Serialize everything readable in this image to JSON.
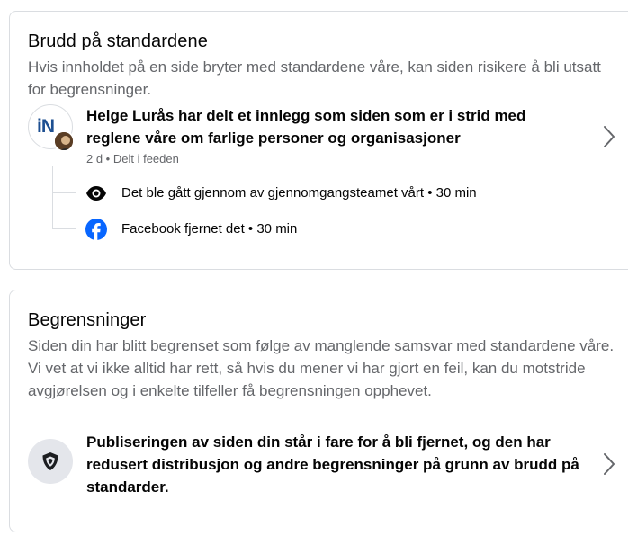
{
  "violations": {
    "title": "Brudd på standardene",
    "description": "Hvis innholdet på en side bryter med standardene våre, kan siden risikere å bli utsatt for begrensninger.",
    "item": {
      "avatar_text": "iN",
      "title": "Helge Lurås har delt et innlegg som siden som er i strid med reglene våre om farlige personer og organisasjoner",
      "meta": "2 d • Delt i feeden",
      "steps": [
        {
          "icon": "eye-icon",
          "text": "Det ble gått gjennom av gjennomgangsteamet vårt • 30 min"
        },
        {
          "icon": "facebook-icon",
          "text": "Facebook fjernet det • 30 min"
        }
      ]
    }
  },
  "restrictions": {
    "title": "Begrensninger",
    "description": "Siden din har blitt begrenset som følge av manglende samsvar med standardene våre. Vi vet at vi ikke alltid har rett, så hvis du mener vi har gjort en feil, kan du motstride avgjørelsen og i enkelte tilfeller få begrensningen opphevet.",
    "item": {
      "icon": "shield-icon",
      "text": "Publiseringen av siden din står i fare for å bli fjernet, og den har redusert distribusjon og andre begrensninger på grunn av brudd på standarder."
    }
  },
  "colors": {
    "facebook_blue": "#0866ff",
    "secondary_text": "#65676b",
    "border": "#dadde1"
  }
}
